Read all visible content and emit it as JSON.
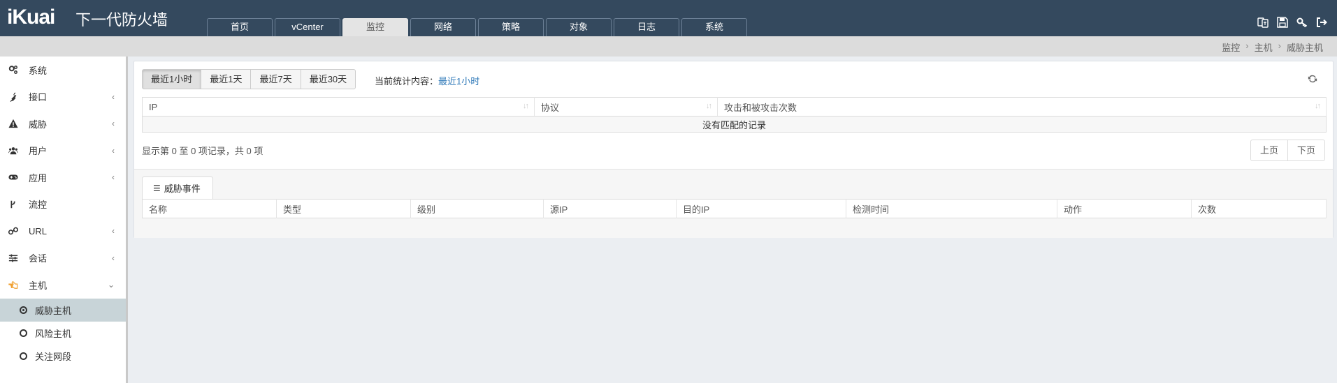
{
  "brand": {
    "logo": "iKuai",
    "subtitle": "下一代防火墙"
  },
  "nav": {
    "tabs": [
      {
        "label": "首页",
        "active": false
      },
      {
        "label": "vCenter",
        "active": false
      },
      {
        "label": "监控",
        "active": true
      },
      {
        "label": "网络",
        "active": false
      },
      {
        "label": "策略",
        "active": false
      },
      {
        "label": "对象",
        "active": false
      },
      {
        "label": "日志",
        "active": false
      },
      {
        "label": "系统",
        "active": false
      }
    ]
  },
  "header_icons": [
    "translate-icon",
    "save-icon",
    "key-icon",
    "logout-icon"
  ],
  "breadcrumb": [
    "监控",
    "主机",
    "威胁主机"
  ],
  "sidebar": {
    "items": [
      {
        "label": "系统",
        "icon": "gears-icon",
        "chevron": ""
      },
      {
        "label": "接口",
        "icon": "plug-icon",
        "chevron": "‹"
      },
      {
        "label": "威胁",
        "icon": "warning-icon",
        "chevron": "‹"
      },
      {
        "label": "用户",
        "icon": "users-icon",
        "chevron": "‹"
      },
      {
        "label": "应用",
        "icon": "gamepad-icon",
        "chevron": "‹"
      },
      {
        "label": "流控",
        "icon": "branch-icon",
        "chevron": ""
      },
      {
        "label": "URL",
        "icon": "link-icon",
        "chevron": "‹"
      },
      {
        "label": "会话",
        "icon": "sliders-icon",
        "chevron": "‹"
      },
      {
        "label": "主机",
        "icon": "hand-pointer-icon",
        "chevron": "⌄"
      }
    ],
    "subitems": [
      {
        "label": "威胁主机",
        "active": true
      },
      {
        "label": "风险主机",
        "active": false
      },
      {
        "label": "关注网段",
        "active": false
      }
    ]
  },
  "main": {
    "range_buttons": [
      {
        "label": "最近1小时",
        "active": true
      },
      {
        "label": "最近1天",
        "active": false
      },
      {
        "label": "最近7天",
        "active": false
      },
      {
        "label": "最近30天",
        "active": false
      }
    ],
    "stat_label": "当前统计内容：",
    "stat_value": "最近1小时",
    "table1": {
      "columns": [
        "IP",
        "协议",
        "攻击和被攻击次数"
      ],
      "empty_text": "没有匹配的记录"
    },
    "info_text": "显示第 0 至 0 项记录，共 0 项",
    "pager": {
      "prev": "上页",
      "next": "下页"
    },
    "event_tab": "威胁事件",
    "table2": {
      "columns": [
        "名称",
        "类型",
        "级别",
        "源IP",
        "目的IP",
        "检测时间",
        "动作",
        "次数"
      ]
    }
  }
}
